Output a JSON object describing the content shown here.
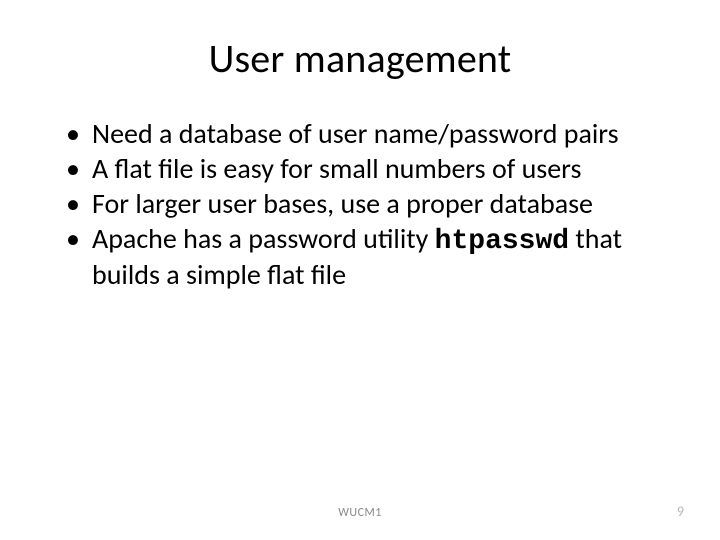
{
  "title": "User management",
  "bullets": [
    {
      "text": "Need a database of user name/password pairs"
    },
    {
      "text": "A flat file is easy for small numbers of users"
    },
    {
      "text": "For larger user bases, use a proper database"
    },
    {
      "prefix": "Apache has a password utility ",
      "code": "htpasswd",
      "suffix": " that builds a simple flat file"
    }
  ],
  "footer": {
    "center": "WUCM1",
    "page": "9"
  }
}
